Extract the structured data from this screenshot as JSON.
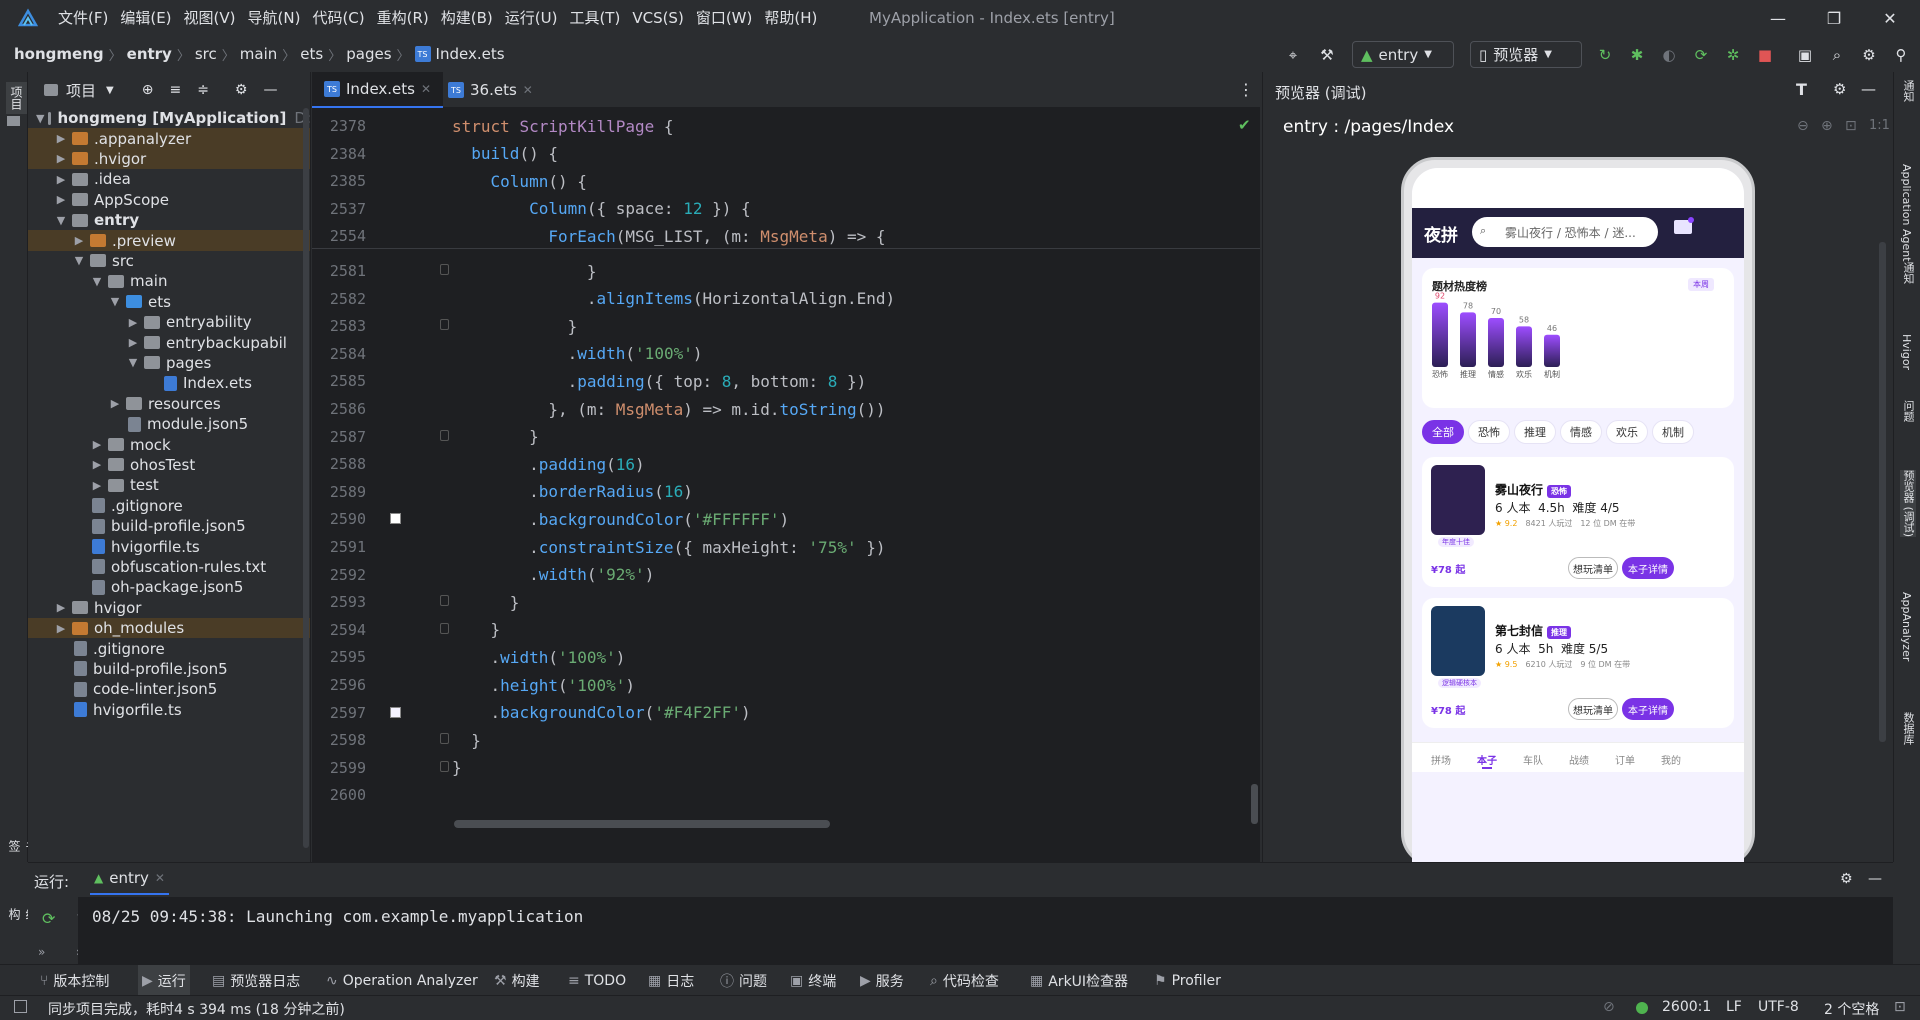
{
  "window": {
    "title": "MyApplication - Index.ets [entry]",
    "menu": [
      "文件(F)",
      "编辑(E)",
      "视图(V)",
      "导航(N)",
      "代码(C)",
      "重构(R)",
      "构建(B)",
      "运行(U)",
      "工具(T)",
      "VCS(S)",
      "窗口(W)",
      "帮助(H)"
    ]
  },
  "breadcrumb": [
    "hongmeng",
    "entry",
    "src",
    "main",
    "ets",
    "pages",
    "Index.ets"
  ],
  "toolbar": {
    "module": "entry",
    "previewer": "预览器"
  },
  "left_strip": {
    "project": "项目",
    "bookmarks": "书签",
    "structure": "结构"
  },
  "project_panel": {
    "title": "项目",
    "tree": [
      {
        "label": "hongmeng [MyApplication]",
        "suffix": "D:",
        "depth": 0,
        "kind": "folder",
        "open": true
      },
      {
        "label": ".appanalyzer",
        "depth": 1,
        "kind": "folder-orange",
        "open": false,
        "hl": true
      },
      {
        "label": ".hvigor",
        "depth": 1,
        "kind": "folder-orange",
        "open": false,
        "hl": true
      },
      {
        "label": ".idea",
        "depth": 1,
        "kind": "folder",
        "open": false
      },
      {
        "label": "AppScope",
        "depth": 1,
        "kind": "folder",
        "open": false
      },
      {
        "label": "entry",
        "depth": 1,
        "kind": "folder",
        "open": true,
        "bold": true
      },
      {
        "label": ".preview",
        "depth": 2,
        "kind": "folder-orange",
        "open": false,
        "hl": true
      },
      {
        "label": "src",
        "depth": 2,
        "kind": "folder",
        "open": true
      },
      {
        "label": "main",
        "depth": 3,
        "kind": "folder",
        "open": true
      },
      {
        "label": "ets",
        "depth": 4,
        "kind": "folder-blue",
        "open": true
      },
      {
        "label": "entryability",
        "depth": 5,
        "kind": "folder",
        "open": false
      },
      {
        "label": "entrybackupabil",
        "depth": 5,
        "kind": "folder",
        "open": false
      },
      {
        "label": "pages",
        "depth": 5,
        "kind": "folder",
        "open": true
      },
      {
        "label": "Index.ets",
        "depth": 6,
        "kind": "file-ts",
        "open": null
      },
      {
        "label": "resources",
        "depth": 4,
        "kind": "folder",
        "open": false
      },
      {
        "label": "module.json5",
        "depth": 4,
        "kind": "file",
        "open": null
      },
      {
        "label": "mock",
        "depth": 3,
        "kind": "folder",
        "open": false
      },
      {
        "label": "ohosTest",
        "depth": 3,
        "kind": "folder",
        "open": false
      },
      {
        "label": "test",
        "depth": 3,
        "kind": "folder",
        "open": false
      },
      {
        "label": ".gitignore",
        "depth": 2,
        "kind": "file",
        "open": null
      },
      {
        "label": "build-profile.json5",
        "depth": 2,
        "kind": "file",
        "open": null
      },
      {
        "label": "hvigorfile.ts",
        "depth": 2,
        "kind": "file-ts",
        "open": null
      },
      {
        "label": "obfuscation-rules.txt",
        "depth": 2,
        "kind": "file",
        "open": null
      },
      {
        "label": "oh-package.json5",
        "depth": 2,
        "kind": "file",
        "open": null
      },
      {
        "label": "hvigor",
        "depth": 1,
        "kind": "folder",
        "open": false
      },
      {
        "label": "oh_modules",
        "depth": 1,
        "kind": "folder-orange",
        "open": false,
        "hl": true
      },
      {
        "label": ".gitignore",
        "depth": 1,
        "kind": "file",
        "open": null
      },
      {
        "label": "build-profile.json5",
        "depth": 1,
        "kind": "file",
        "open": null
      },
      {
        "label": "code-linter.json5",
        "depth": 1,
        "kind": "file",
        "open": null
      },
      {
        "label": "hvigorfile.ts",
        "depth": 1,
        "kind": "file-ts",
        "open": null
      }
    ]
  },
  "editor": {
    "tabs": [
      {
        "label": "Index.ets",
        "active": true
      },
      {
        "label": "36.ets",
        "active": false
      }
    ],
    "sticky": [
      {
        "ln": "2378",
        "html": "<span class='kw'>struct</span> <span class='ty'>ScriptKillPage</span> {"
      },
      {
        "ln": "2384",
        "html": "  <span class='fn'>build</span>() {"
      },
      {
        "ln": "2385",
        "html": "    <span class='fn'>Column</span>() {"
      },
      {
        "ln": "2537",
        "html": "        <span class='fn'>Column</span>({ space: <span class='nu'>12</span> }) {"
      },
      {
        "ln": "2554",
        "html": "          <span class='fn'>ForEach</span>(MSG_LIST, (m: <span class='kw'>MsgMeta</span>) => {"
      }
    ],
    "lines": [
      {
        "ln": "2581",
        "html": "              }"
      },
      {
        "ln": "2582",
        "html": "              .<span class='fn'>alignItems</span>(HorizontalAlign.End)"
      },
      {
        "ln": "2583",
        "html": "            }"
      },
      {
        "ln": "2584",
        "html": "            .<span class='fn'>width</span>(<span class='st'>'100%'</span>)"
      },
      {
        "ln": "2585",
        "html": "            .<span class='fn'>padding</span>({ top: <span class='nu'>8</span>, bottom: <span class='nu'>8</span> })"
      },
      {
        "ln": "2586",
        "html": "          }, (m: <span class='kw'>MsgMeta</span>) => m.id.<span class='fn'>toString</span>())"
      },
      {
        "ln": "2587",
        "html": "        }"
      },
      {
        "ln": "2588",
        "html": "        .<span class='fn'>padding</span>(<span class='nu'>16</span>)"
      },
      {
        "ln": "2589",
        "html": "        .<span class='fn'>borderRadius</span>(<span class='nu'>16</span>)"
      },
      {
        "ln": "2590",
        "html": "        .<span class='fn'>backgroundColor</span>(<span class='st'>'#FFFFFF'</span>)"
      },
      {
        "ln": "2591",
        "html": "        .<span class='fn'>constraintSize</span>({ maxHeight: <span class='st'>'75%'</span> })"
      },
      {
        "ln": "2592",
        "html": "        .<span class='fn'>width</span>(<span class='st'>'92%'</span>)"
      },
      {
        "ln": "2593",
        "html": "      }"
      },
      {
        "ln": "2594",
        "html": "    }"
      },
      {
        "ln": "2595",
        "html": "    .<span class='fn'>width</span>(<span class='st'>'100%'</span>)"
      },
      {
        "ln": "2596",
        "html": "    .<span class='fn'>height</span>(<span class='st'>'100%'</span>)"
      },
      {
        "ln": "2597",
        "html": "    .<span class='fn'>backgroundColor</span>(<span class='st'>'#F4F2FF'</span>)"
      },
      {
        "ln": "2598",
        "html": "  }"
      },
      {
        "ln": "2599",
        "html": "}"
      },
      {
        "ln": "2600",
        "html": ""
      }
    ]
  },
  "preview": {
    "panel_title": "预览器 (调试)",
    "route": "entry : /pages/Index",
    "app": {
      "brand": "夜拼",
      "search_placeholder": "雾山夜行 / 恐怖本 / 迷...",
      "heat": {
        "title": "题材热度榜",
        "badge": "本周"
      },
      "chips": [
        "全部",
        "恐怖",
        "推理",
        "情感",
        "欢乐",
        "机制"
      ],
      "cards": [
        {
          "title": "雾山夜行",
          "tag": "恐怖",
          "info": "6 人本  4.5h  难度 4/5",
          "rating": "★ 9.2",
          "played": "8421 人玩过",
          "dm": "12 位 DM 在带",
          "cover_tag": "年度十佳",
          "price": "¥78 起",
          "btn1": "想玩清单",
          "btn2": "本子详情",
          "cover": "#2e2150"
        },
        {
          "title": "第七封信",
          "tag": "推理",
          "info": "6 人本  5h  难度 5/5",
          "rating": "★ 9.5",
          "played": "6210 人玩过",
          "dm": "9 位 DM 在带",
          "cover_tag": "逻辑硬核本",
          "price": "¥78 起",
          "btn1": "想玩清单",
          "btn2": "本子详情",
          "cover": "#1b3a60"
        }
      ],
      "bottom_nav": [
        "拼场",
        "本子",
        "车队",
        "战绩",
        "订单",
        "我的"
      ],
      "active_nav": 1
    }
  },
  "right_strip": [
    "通知",
    "Application Agent",
    "通知",
    "Hvigor",
    "问题",
    "预览器 (调试)",
    "AppAnalyzer",
    "数据库"
  ],
  "run_panel": {
    "label": "运行:",
    "config": "entry",
    "console": "08/25 09:45:38: Launching com.example.myapplication"
  },
  "bottom_tabs": [
    "版本控制",
    "运行",
    "预览器日志",
    "Operation Analyzer",
    "构建",
    "TODO",
    "日志",
    "问题",
    "终端",
    "服务",
    "代码检查",
    "ArkUI检查器",
    "Profiler"
  ],
  "status": {
    "message": "同步项目完成，耗时4 s 394 ms (18 分钟之前)",
    "position": "2600:1",
    "line_sep": "LF",
    "encoding": "UTF-8",
    "indent": "2 个空格"
  },
  "chart_data": {
    "type": "bar",
    "categories": [
      "恐怖",
      "推理",
      "情感",
      "欢乐",
      "机制"
    ],
    "values": [
      92,
      78,
      70,
      58,
      46
    ],
    "title": "题材热度榜",
    "ylim": [
      0,
      100
    ]
  }
}
